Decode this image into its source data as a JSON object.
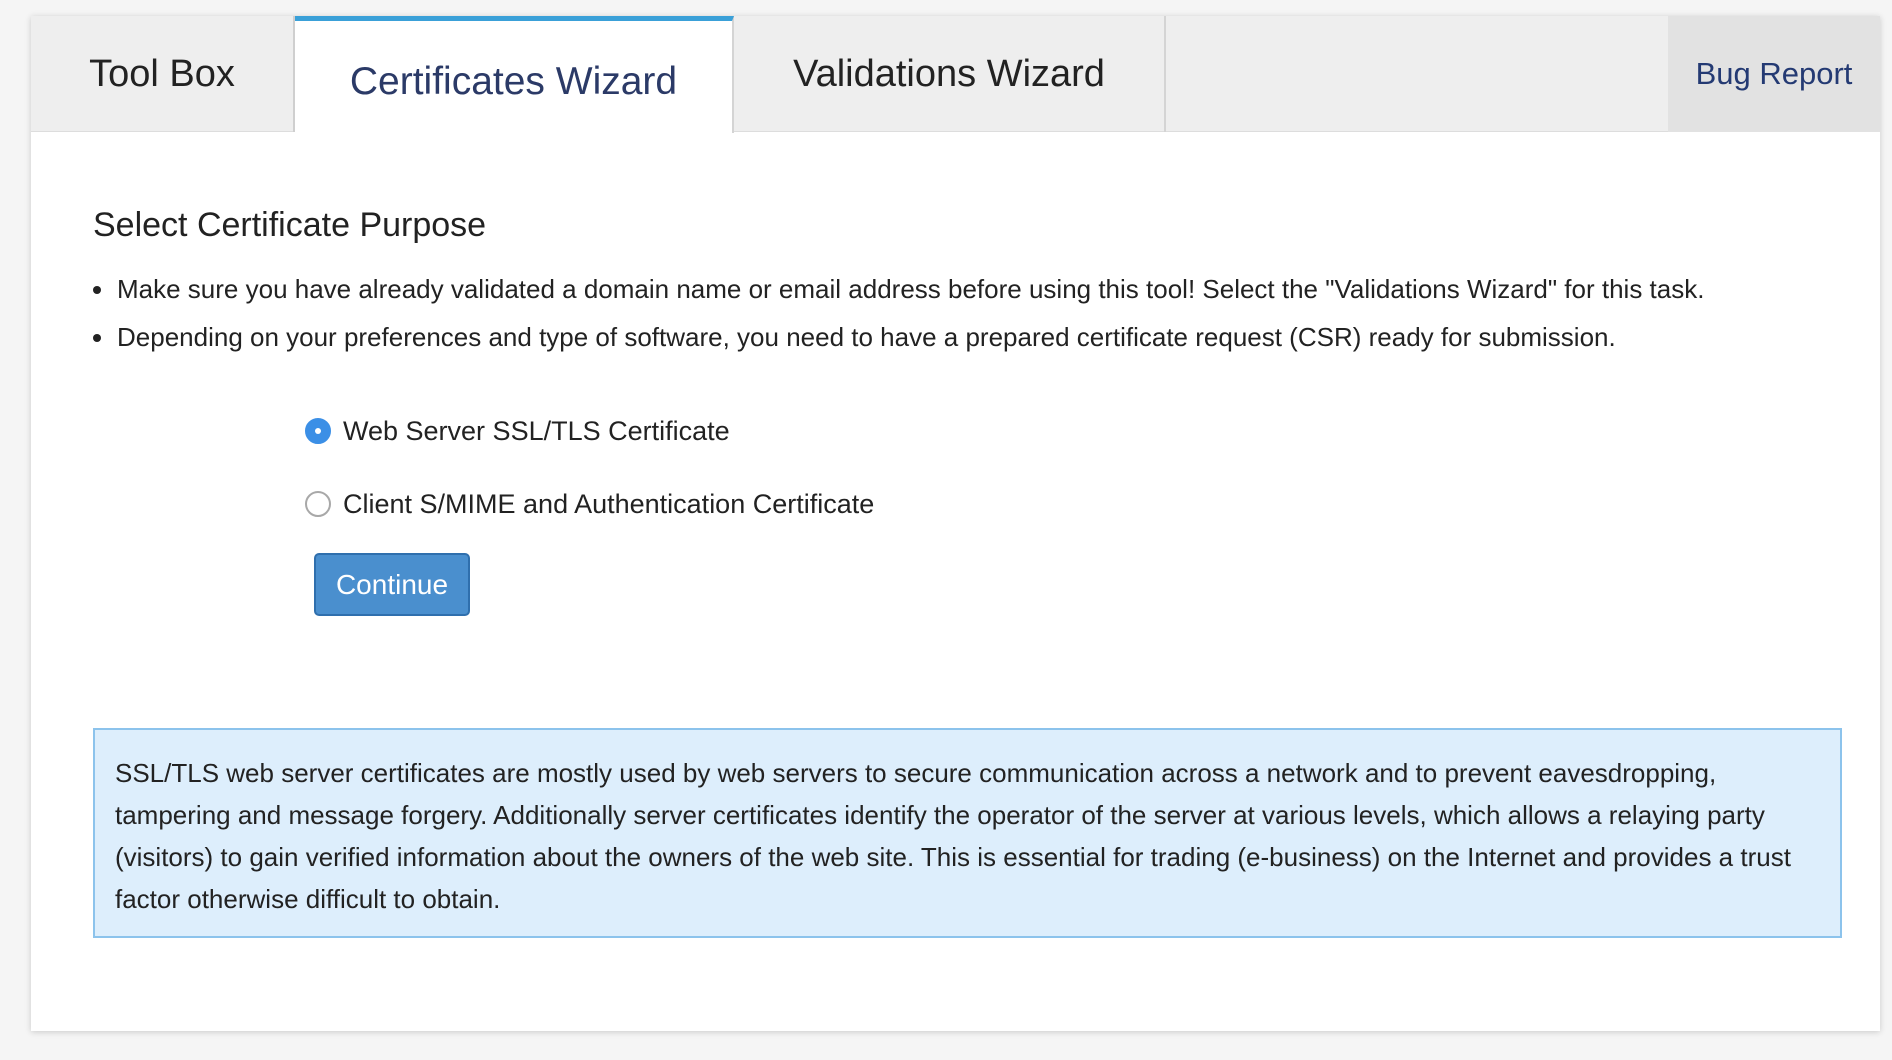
{
  "tabs": {
    "toolbox": "Tool Box",
    "certificates": "Certificates Wizard",
    "validations": "Validations Wizard",
    "bug_report": "Bug Report"
  },
  "main": {
    "heading": "Select Certificate Purpose",
    "notes": [
      "Make sure you have already validated a domain name or email address before using this tool! Select the \"Validations Wizard\" for this task.",
      "Depending on your preferences and type of software, you need to have a prepared certificate request (CSR) ready for submission."
    ],
    "options": [
      {
        "label": "Web Server SSL/TLS Certificate",
        "selected": true
      },
      {
        "label": "Client S/MIME and Authentication Certificate",
        "selected": false
      }
    ],
    "continue_label": "Continue",
    "info_text": "SSL/TLS web server certificates are mostly used by web servers to secure communication across a network and to prevent eavesdropping, tampering and message forgery. Additionally server certificates identify the operator of the server at various levels, which allows a relaying party (visitors) to gain verified information about the owners of the web site. This is essential for trading (e-business) on the Internet and provides a trust factor otherwise difficult to obtain."
  },
  "colors": {
    "active_tab_accent": "#3aa0d8",
    "button_blue": "#4a8fce",
    "radio_selected": "#3b8fe6",
    "info_background": "#ddeefc",
    "info_border": "#8cc3ec",
    "link_navy": "#243a73"
  }
}
